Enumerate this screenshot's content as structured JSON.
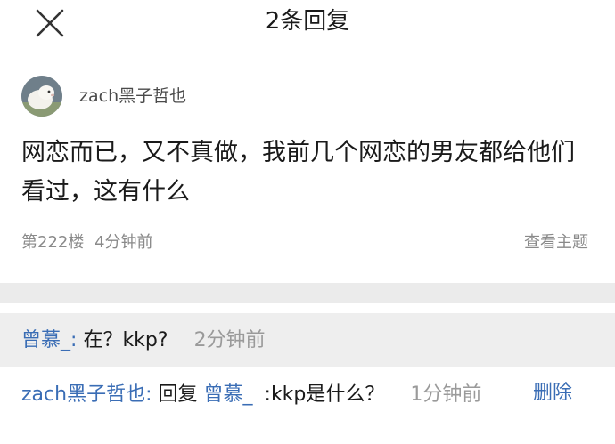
{
  "header": {
    "close_icon": "close-icon",
    "title": "2条回复"
  },
  "post": {
    "author": "zach黑子哲也",
    "content": "网恋而已，又不真做，我前几个网恋的男友都给他们看过，这有什么",
    "floor": "第222楼",
    "time": "4分钟前",
    "view_thread": "查看主题"
  },
  "replies": [
    {
      "user": "曾慕_",
      "separator": ":",
      "text": "在？kkp?",
      "time": "2分钟前"
    },
    {
      "user": "zach黑子哲也",
      "separator": ":",
      "reply_word": "回复",
      "target": "曾慕_",
      "text": ":kkp是什么？",
      "time": "1分钟前",
      "delete_label": "删除"
    }
  ],
  "colors": {
    "link": "#3a6db5",
    "gap": "#ebebeb",
    "highlight_row": "#eeeeee"
  }
}
